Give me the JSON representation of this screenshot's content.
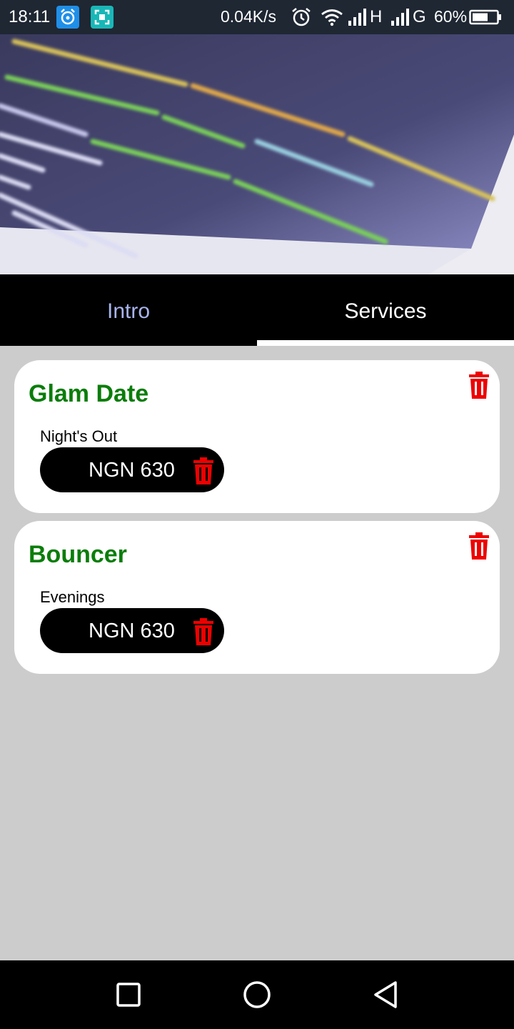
{
  "status_bar": {
    "time": "18:11",
    "net_speed": "0.04K/s",
    "network_1": "H",
    "network_2": "G",
    "battery": "60%",
    "icons": [
      "app-notification-icon",
      "screenshot-icon",
      "alarm-icon",
      "wifi-icon",
      "signal-icon",
      "signal-icon",
      "battery-icon"
    ]
  },
  "tabs": [
    {
      "label": "Intro",
      "selected": false
    },
    {
      "label": "Services",
      "selected": true
    }
  ],
  "services": [
    {
      "title": "Glam Date",
      "items": [
        {
          "label": "Night's Out",
          "price": "NGN 630"
        }
      ]
    },
    {
      "title": "Bouncer",
      "items": [
        {
          "label": "Evenings",
          "price": "NGN 630"
        }
      ]
    }
  ],
  "nav_bar": {
    "buttons": [
      "recents-icon",
      "home-icon",
      "back-icon"
    ]
  },
  "colors": {
    "title_green": "#0a7d0a",
    "delete_red": "#ee0000",
    "tab_inactive": "#a8b4ee",
    "background": "#cccccc"
  }
}
